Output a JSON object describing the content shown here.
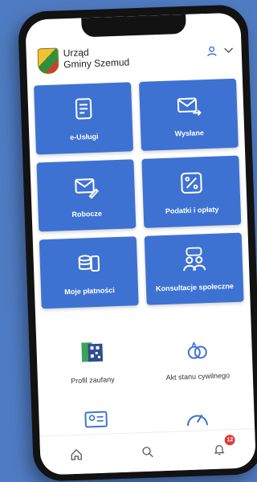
{
  "header": {
    "title_line1": "Urząd",
    "title_line2": "Gminy Szemud"
  },
  "tiles": [
    {
      "label": "e-Usługi",
      "icon": "document-icon"
    },
    {
      "label": "Wysłane",
      "icon": "sent-mail-icon"
    },
    {
      "label": "Robocze",
      "icon": "draft-mail-icon"
    },
    {
      "label": "Podatki i opłaty",
      "icon": "percent-icon"
    },
    {
      "label": "Moje płatności",
      "icon": "coins-icon"
    },
    {
      "label": "Konsultacje społeczne",
      "icon": "people-chat-icon"
    }
  ],
  "secondary": [
    {
      "label": "Profil zaufany",
      "icon": "qr-icon"
    },
    {
      "label": "Akt stanu cywilnego",
      "icon": "rings-icon"
    }
  ],
  "nav": {
    "notification_count": "12"
  },
  "colors": {
    "background": "#4f7bc2",
    "tile": "#3e72d2",
    "badge": "#e0393b"
  }
}
